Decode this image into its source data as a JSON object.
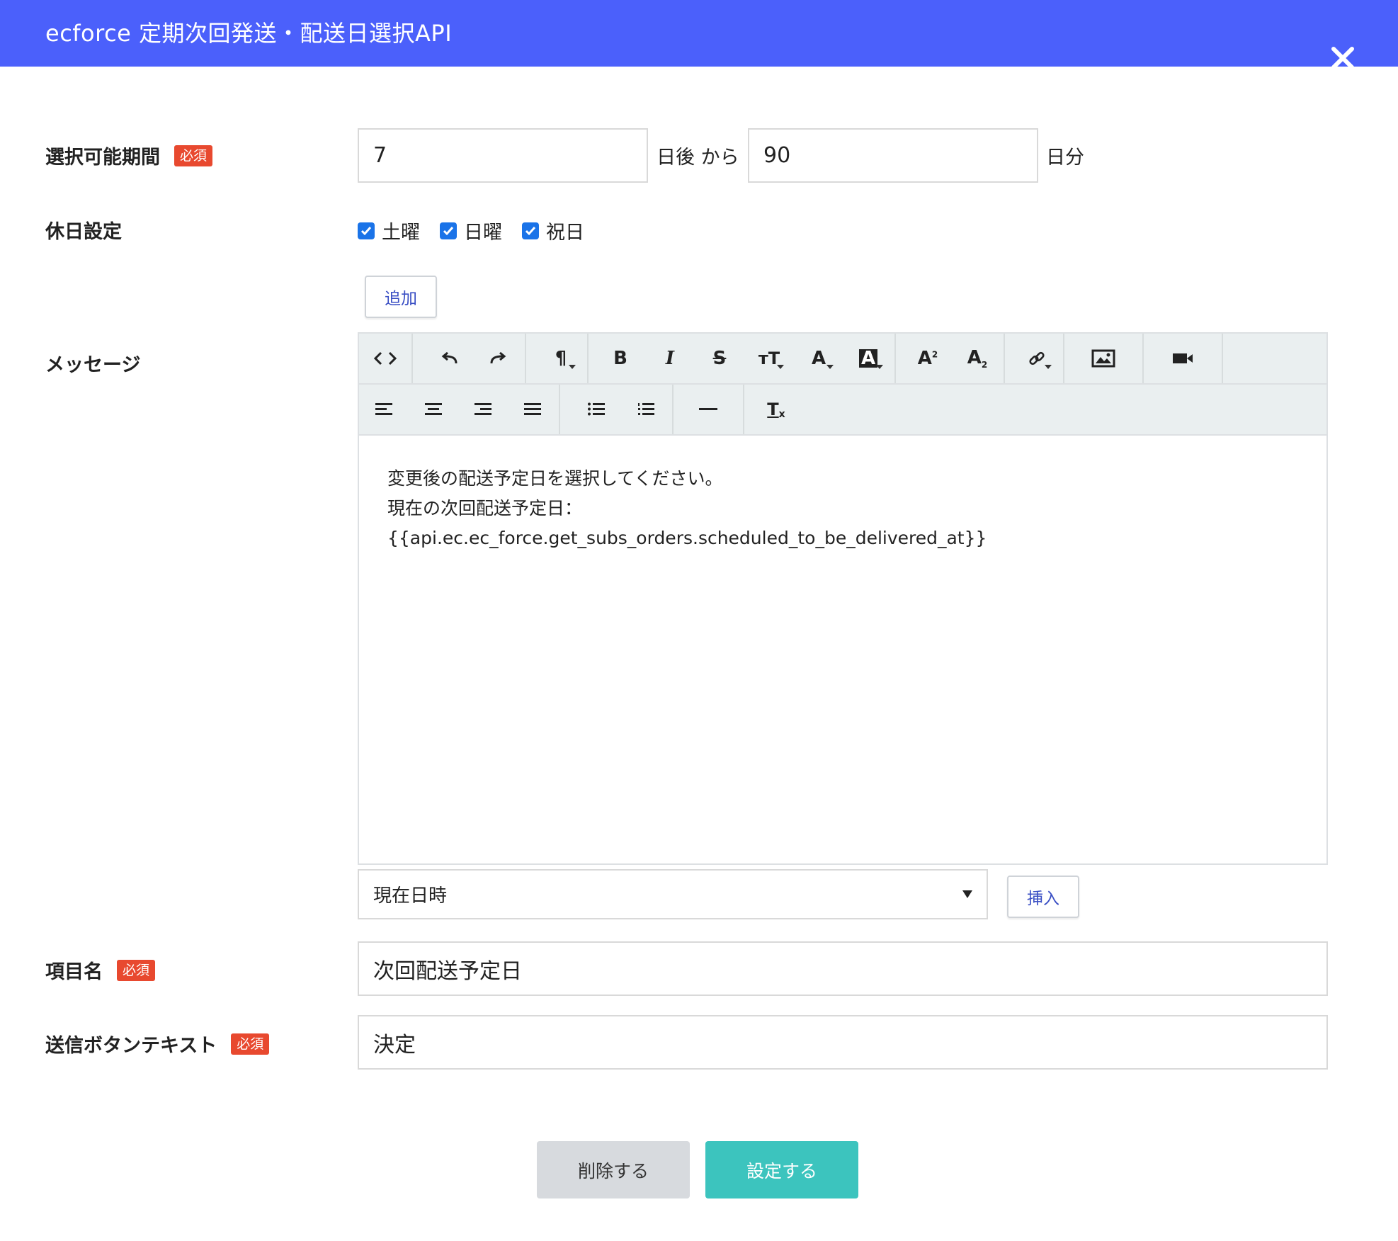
{
  "header": {
    "title": "ecforce 定期次回発送・配送日選択API"
  },
  "form": {
    "period": {
      "label": "選択可能期間",
      "required": "必須",
      "from_value": "7",
      "from_unit": "日後 から",
      "to_value": "90",
      "to_unit": "日分"
    },
    "holiday": {
      "label": "休日設定",
      "options": [
        {
          "label": "土曜",
          "checked": true
        },
        {
          "label": "日曜",
          "checked": true
        },
        {
          "label": "祝日",
          "checked": true
        }
      ],
      "add_label": "追加"
    },
    "message": {
      "label": "メッセージ",
      "content_lines": [
        "変更後の配送予定日を選択してください。",
        "現在の次回配送予定日：",
        "{{api.ec.ec_force.get_subs_orders.scheduled_to_be_delivered_at}}"
      ],
      "variable_select": "現在日時",
      "insert_label": "挿入"
    },
    "item_name": {
      "label": "項目名",
      "required": "必須",
      "value": "次回配送予定日"
    },
    "submit_text": {
      "label": "送信ボタンテキスト",
      "required": "必須",
      "value": "決定"
    }
  },
  "actions": {
    "delete_label": "削除する",
    "save_label": "設定する"
  },
  "colors": {
    "header": "#4b60fb",
    "required_badge": "#e8492f",
    "save_button": "#3cc4be",
    "checkbox": "#1a73e8"
  }
}
